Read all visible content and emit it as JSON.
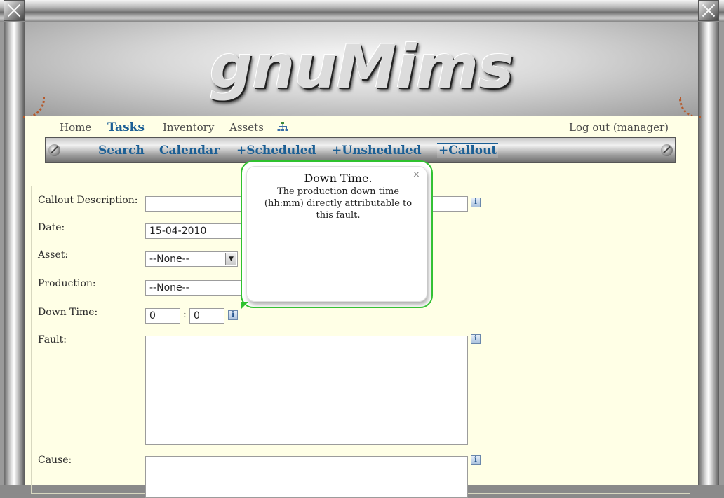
{
  "app": {
    "logo_text": "gnuMims"
  },
  "topnav": {
    "items": [
      {
        "label": "Home"
      },
      {
        "label": "Tasks"
      },
      {
        "label": "Inventory"
      },
      {
        "label": "Assets"
      }
    ],
    "logout_label": "Log out (manager)"
  },
  "subnav": {
    "items": [
      {
        "label": "Search"
      },
      {
        "label": "Calendar"
      },
      {
        "label": "+Scheduled"
      },
      {
        "label": "+Unsheduled"
      },
      {
        "label": "+Callout"
      }
    ]
  },
  "form": {
    "callout_description": {
      "label": "Callout Description:",
      "value": ""
    },
    "date": {
      "label": "Date:",
      "value": "15-04-2010"
    },
    "asset": {
      "label": "Asset:",
      "value": "--None--"
    },
    "production": {
      "label": "Production:",
      "value": "--None--"
    },
    "down_time": {
      "label": "Down Time:",
      "hours": "0",
      "separator": ":",
      "minutes": "0"
    },
    "fault": {
      "label": "Fault:",
      "value": ""
    },
    "cause": {
      "label": "Cause:",
      "value": ""
    }
  },
  "tooltip": {
    "title": "Down Time.",
    "body": "The production down time (hh:mm) directly attributable to this fault.",
    "close": "×"
  },
  "icons": {
    "info": "i"
  },
  "colors": {
    "nav_active": "#1b5f95",
    "content_bg": "#ffffe6",
    "tooltip_border": "#2fc22f",
    "highlight_ring": "#d21a1a"
  }
}
